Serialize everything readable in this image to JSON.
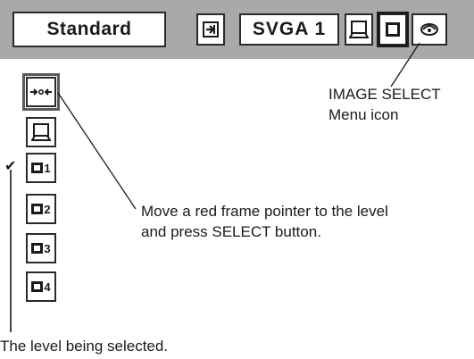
{
  "menubar": {
    "mode_label": "Standard",
    "resolution_label": "SVGA 1",
    "icons": [
      "input-icon",
      "pc-adjust-icon",
      "image-select-icon",
      "sound-icon"
    ]
  },
  "level_column": {
    "items": [
      {
        "icon": "image-adjust-icon"
      },
      {
        "icon": "pc-adjust-icon"
      },
      {
        "icon": "level-icon",
        "number": "1",
        "checked": true
      },
      {
        "icon": "level-icon",
        "number": "2"
      },
      {
        "icon": "level-icon",
        "number": "3"
      },
      {
        "icon": "level-icon",
        "number": "4"
      }
    ],
    "check_glyph": "✔"
  },
  "annotations": {
    "image_select_line1": "IMAGE SELECT",
    "image_select_line2": "Menu icon",
    "pointer_line1": "Move a red frame pointer to the level",
    "pointer_line2": "and press SELECT button.",
    "level_selected": "The level being selected."
  }
}
